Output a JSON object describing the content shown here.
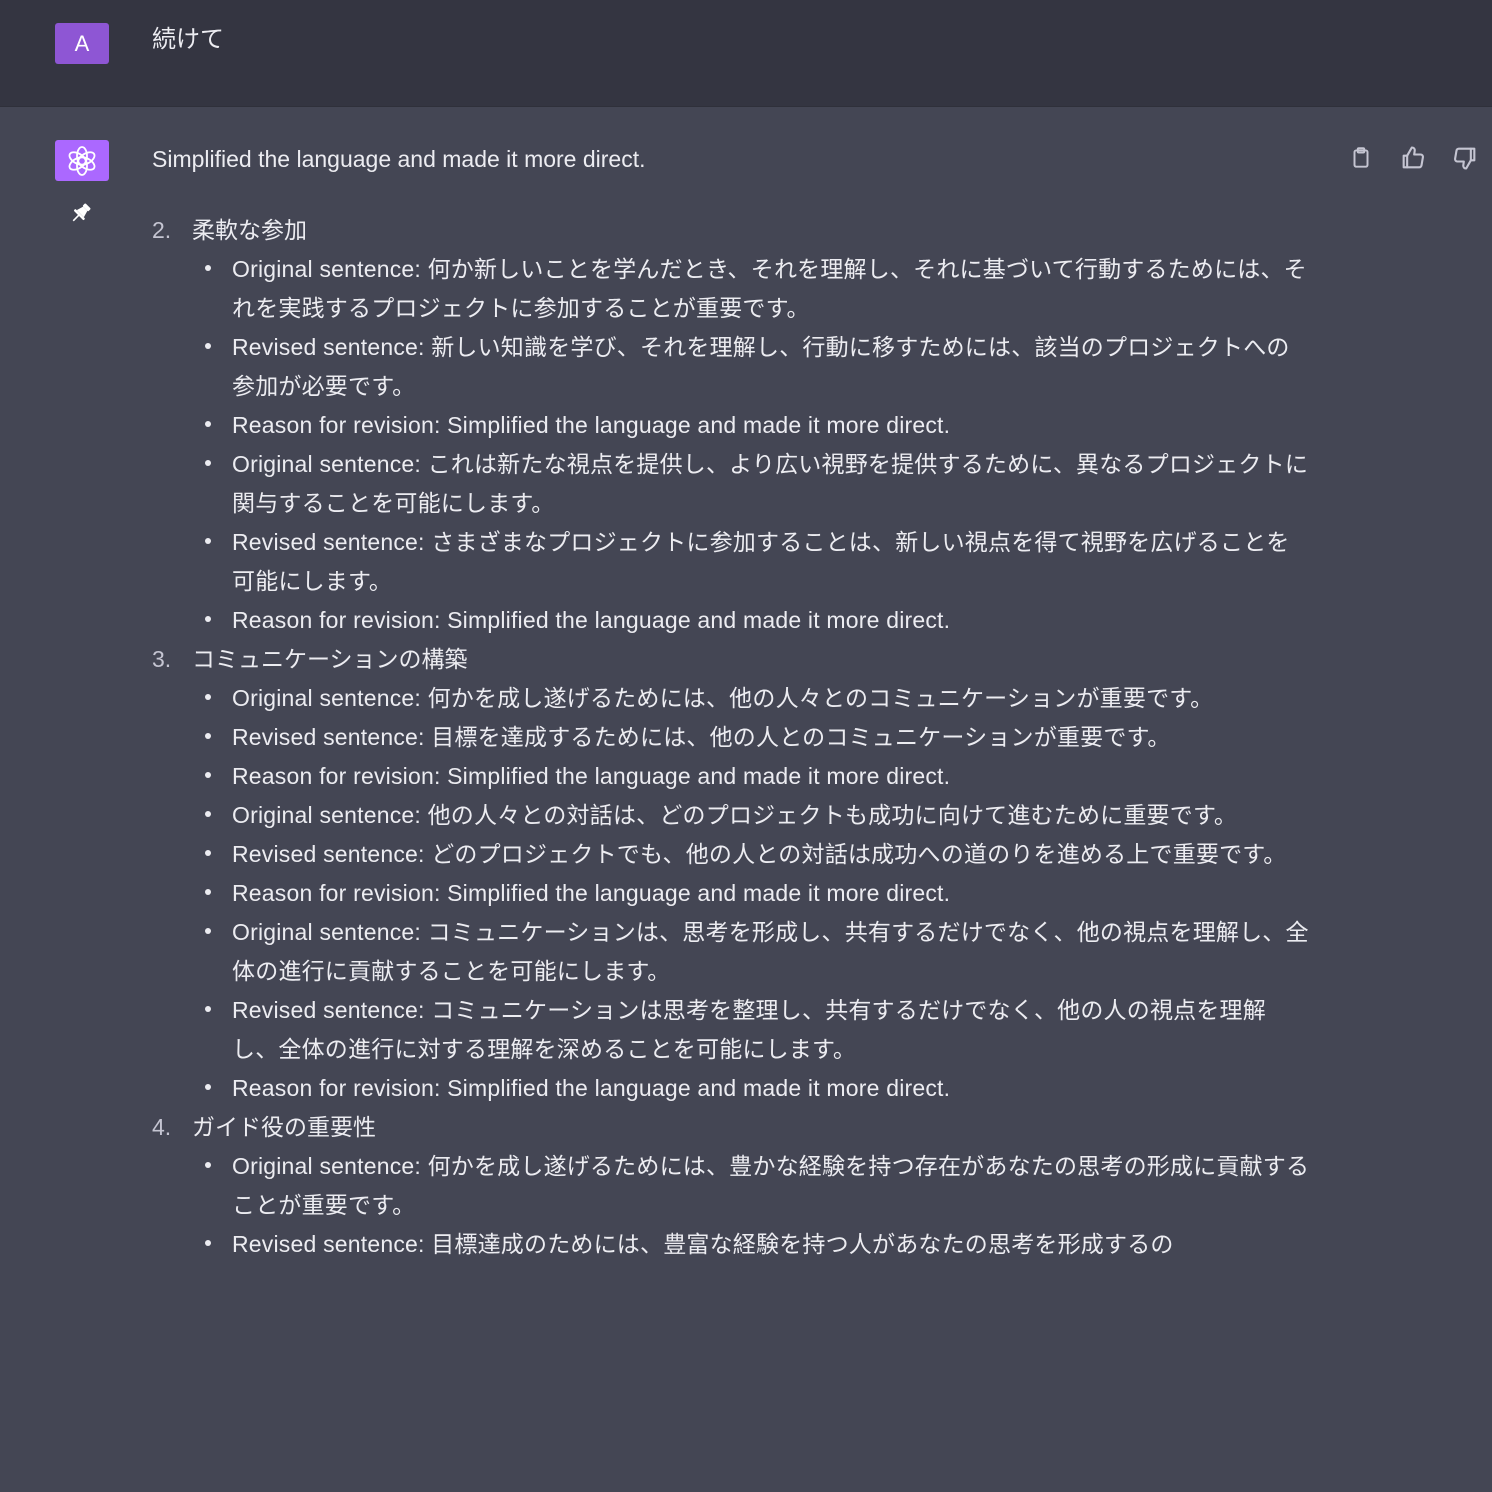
{
  "user": {
    "avatar_letter": "A",
    "message": "続けて"
  },
  "assistant": {
    "intro": "Simplified the language and made it more direct.",
    "sections": [
      {
        "num": "2.",
        "title": "柔軟な参加",
        "items": [
          "Original sentence: 何か新しいことを学んだとき、それを理解し、それに基づいて行動するためには、それを実践するプロジェクトに参加することが重要です。",
          "Revised sentence: 新しい知識を学び、それを理解し、行動に移すためには、該当のプロジェクトへの参加が必要です。",
          "Reason for revision: Simplified the language and made it more direct.",
          "Original sentence: これは新たな視点を提供し、より広い視野を提供するために、異なるプロジェクトに関与することを可能にします。",
          "Revised sentence: さまざまなプロジェクトに参加することは、新しい視点を得て視野を広げることを可能にします。",
          "Reason for revision: Simplified the language and made it more direct."
        ]
      },
      {
        "num": "3.",
        "title": "コミュニケーションの構築",
        "items": [
          "Original sentence: 何かを成し遂げるためには、他の人々とのコミュニケーションが重要です。",
          "Revised sentence: 目標を達成するためには、他の人とのコミュニケーションが重要です。",
          "Reason for revision: Simplified the language and made it more direct.",
          "Original sentence: 他の人々との対話は、どのプロジェクトも成功に向けて進むために重要です。",
          "Revised sentence: どのプロジェクトでも、他の人との対話は成功への道のりを進める上で重要です。",
          "Reason for revision: Simplified the language and made it more direct.",
          "Original sentence: コミュニケーションは、思考を形成し、共有するだけでなく、他の視点を理解し、全体の進行に貢献することを可能にします。",
          "Revised sentence: コミュニケーションは思考を整理し、共有するだけでなく、他の人の視点を理解し、全体の進行に対する理解を深めることを可能にします。",
          "Reason for revision: Simplified the language and made it more direct."
        ]
      },
      {
        "num": "4.",
        "title": "ガイド役の重要性",
        "items": [
          "Original sentence: 何かを成し遂げるためには、豊かな経験を持つ存在があなたの思考の形成に貢献することが重要です。",
          "Revised sentence: 目標達成のためには、豊富な経験を持つ人があなたの思考を形成するの"
        ]
      }
    ]
  },
  "icons": {
    "bot_avatar": "openai-logo-icon",
    "pin": "pin-icon",
    "copy": "clipboard-icon",
    "like": "thumbs-up-icon",
    "dislike": "thumbs-down-icon"
  },
  "colors": {
    "user_bg": "#343541",
    "assistant_bg": "#444654",
    "user_avatar": "#8e56d4",
    "bot_avatar": "#ab68ff"
  }
}
